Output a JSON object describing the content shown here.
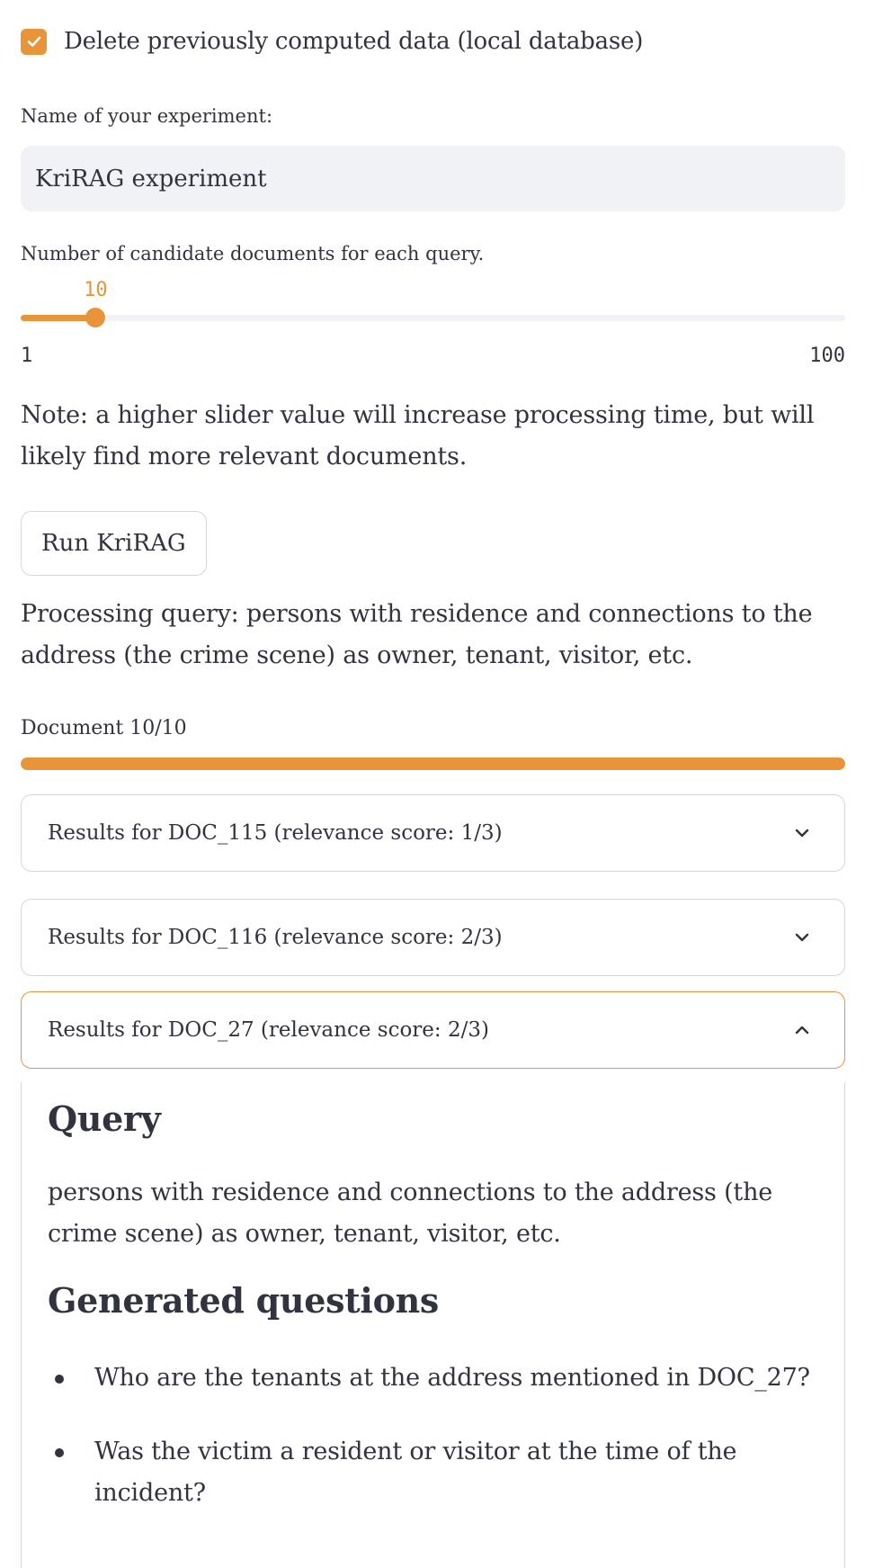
{
  "settings": {
    "delete_checkbox": {
      "label": "Delete previously computed data (local database)",
      "checked": true
    },
    "experiment_name": {
      "label": "Name of your experiment:",
      "value": "KriRAG experiment"
    },
    "candidate_slider": {
      "label": "Number of candidate documents for each query.",
      "value": "10",
      "min": "1",
      "max": "100"
    },
    "note": "Note: a higher slider value will increase processing time, but will likely find more relevant documents.",
    "run_button": "Run KriRAG"
  },
  "processing": {
    "query_text": "Processing query: persons with residence and connections to the address (the crime scene) as owner, tenant, visitor, etc.",
    "progress_label": "Document 10/10",
    "progress_value": 1.0
  },
  "results": [
    {
      "label": "Results for DOC_115 (relevance score: 1/3)",
      "expanded": false
    },
    {
      "label": "Results for DOC_116 (relevance score: 2/3)",
      "expanded": false
    },
    {
      "label": "Results for DOC_27 (relevance score: 2/3)",
      "expanded": true
    }
  ],
  "expanded_result": {
    "query_heading": "Query",
    "query_text": "persons with residence and connections to the address (the crime scene) as owner, tenant, visitor, etc.",
    "questions_heading": "Generated questions",
    "questions": [
      "Who are the tenants at the address mentioned in DOC_27?",
      "Was the victim a resident or visitor at the time of the incident?"
    ]
  },
  "colors": {
    "accent": "#e8943a",
    "text": "#31333f",
    "input_bg": "#f0f2f6",
    "border": "#d5d6db"
  }
}
